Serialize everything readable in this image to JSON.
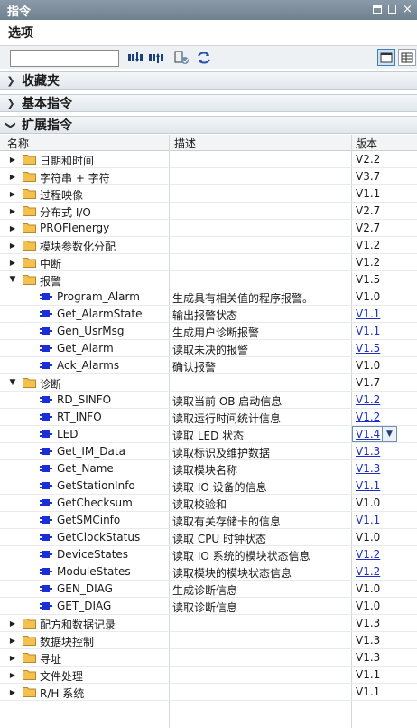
{
  "window": {
    "title": "指令"
  },
  "options": {
    "label": "选项",
    "search_value": ""
  },
  "sections": {
    "favorites": "收藏夹",
    "basic": "基本指令",
    "extended": "扩展指令"
  },
  "columns": {
    "name": "名称",
    "desc": "描述",
    "version": "版本"
  },
  "colors": {
    "titlebar": "#7a8b99",
    "folder": "#f4c04e",
    "instruction_icon": "#1a2fd6",
    "link": "#1d2fc4"
  },
  "rows": [
    {
      "level": 0,
      "type": "folder",
      "expanded": false,
      "name": "日期和时间",
      "desc": "",
      "version": "V2.2",
      "link": false
    },
    {
      "level": 0,
      "type": "folder",
      "expanded": false,
      "name": "字符串 + 字符",
      "desc": "",
      "version": "V3.7",
      "link": false
    },
    {
      "level": 0,
      "type": "folder",
      "expanded": false,
      "name": "过程映像",
      "desc": "",
      "version": "V1.1",
      "link": false
    },
    {
      "level": 0,
      "type": "folder",
      "expanded": false,
      "name": "分布式 I/O",
      "desc": "",
      "version": "V2.7",
      "link": false
    },
    {
      "level": 0,
      "type": "folder",
      "expanded": false,
      "name": "PROFIenergy",
      "desc": "",
      "version": "V2.7",
      "link": false
    },
    {
      "level": 0,
      "type": "folder",
      "expanded": false,
      "name": "模块参数化分配",
      "desc": "",
      "version": "V1.2",
      "link": false
    },
    {
      "level": 0,
      "type": "folder",
      "expanded": false,
      "name": "中断",
      "desc": "",
      "version": "V1.2",
      "link": false
    },
    {
      "level": 0,
      "type": "folder",
      "expanded": true,
      "name": "报警",
      "desc": "",
      "version": "V1.5",
      "link": false
    },
    {
      "level": 1,
      "type": "instr",
      "name": "Program_Alarm",
      "desc": "生成具有相关值的程序报警。",
      "version": "V1.0",
      "link": false
    },
    {
      "level": 1,
      "type": "instr",
      "name": "Get_AlarmState",
      "desc": "输出报警状态",
      "version": "V1.1",
      "link": true
    },
    {
      "level": 1,
      "type": "instr",
      "name": "Gen_UsrMsg",
      "desc": "生成用户诊断报警",
      "version": "V1.1",
      "link": true
    },
    {
      "level": 1,
      "type": "instr",
      "name": "Get_Alarm",
      "desc": "读取未决的报警",
      "version": "V1.5",
      "link": true
    },
    {
      "level": 1,
      "type": "instr",
      "name": "Ack_Alarms",
      "desc": "确认报警",
      "version": "V1.0",
      "link": false
    },
    {
      "level": 0,
      "type": "folder",
      "expanded": true,
      "name": "诊断",
      "desc": "",
      "version": "V1.7",
      "link": false
    },
    {
      "level": 1,
      "type": "instr",
      "name": "RD_SINFO",
      "desc": "读取当前 OB 启动信息",
      "version": "V1.2",
      "link": true
    },
    {
      "level": 1,
      "type": "instr",
      "name": "RT_INFO",
      "desc": "读取运行时间统计信息",
      "version": "V1.2",
      "link": true
    },
    {
      "level": 1,
      "type": "instr",
      "name": "LED",
      "desc": "读取 LED 状态",
      "version": "V1.4",
      "link": true,
      "selected": true
    },
    {
      "level": 1,
      "type": "instr",
      "name": "Get_IM_Data",
      "desc": "读取标识及维护数据",
      "version": "V1.3",
      "link": true
    },
    {
      "level": 1,
      "type": "instr",
      "name": "Get_Name",
      "desc": "读取模块名称",
      "version": "V1.3",
      "link": true
    },
    {
      "level": 1,
      "type": "instr",
      "name": "GetStationInfo",
      "desc": "读取 IO 设备的信息",
      "version": "V1.1",
      "link": true
    },
    {
      "level": 1,
      "type": "instr",
      "name": "GetChecksum",
      "desc": "读取校验和",
      "version": "V1.0",
      "link": false
    },
    {
      "level": 1,
      "type": "instr",
      "name": "GetSMCinfo",
      "desc": "读取有关存储卡的信息",
      "version": "V1.1",
      "link": true
    },
    {
      "level": 1,
      "type": "instr",
      "name": "GetClockStatus",
      "desc": "读取 CPU 时钟状态",
      "version": "V1.0",
      "link": false
    },
    {
      "level": 1,
      "type": "instr",
      "name": "DeviceStates",
      "desc": "读取 IO 系统的模块状态信息",
      "version": "V1.2",
      "link": true
    },
    {
      "level": 1,
      "type": "instr",
      "name": "ModuleStates",
      "desc": "读取模块的模块状态信息",
      "version": "V1.2",
      "link": true
    },
    {
      "level": 1,
      "type": "instr",
      "name": "GEN_DIAG",
      "desc": "生成诊断信息",
      "version": "V1.0",
      "link": false
    },
    {
      "level": 1,
      "type": "instr",
      "name": "GET_DIAG",
      "desc": "读取诊断信息",
      "version": "V1.0",
      "link": false
    },
    {
      "level": 0,
      "type": "folder",
      "expanded": false,
      "name": "配方和数据记录",
      "desc": "",
      "version": "V1.3",
      "link": false
    },
    {
      "level": 0,
      "type": "folder",
      "expanded": false,
      "name": "数据块控制",
      "desc": "",
      "version": "V1.3",
      "link": false
    },
    {
      "level": 0,
      "type": "folder",
      "expanded": false,
      "name": "寻址",
      "desc": "",
      "version": "V1.3",
      "link": false
    },
    {
      "level": 0,
      "type": "folder",
      "expanded": false,
      "name": "文件处理",
      "desc": "",
      "version": "V1.1",
      "link": false
    },
    {
      "level": 0,
      "type": "folder",
      "expanded": false,
      "name": "R/H 系统",
      "desc": "",
      "version": "V1.1",
      "link": false
    }
  ]
}
